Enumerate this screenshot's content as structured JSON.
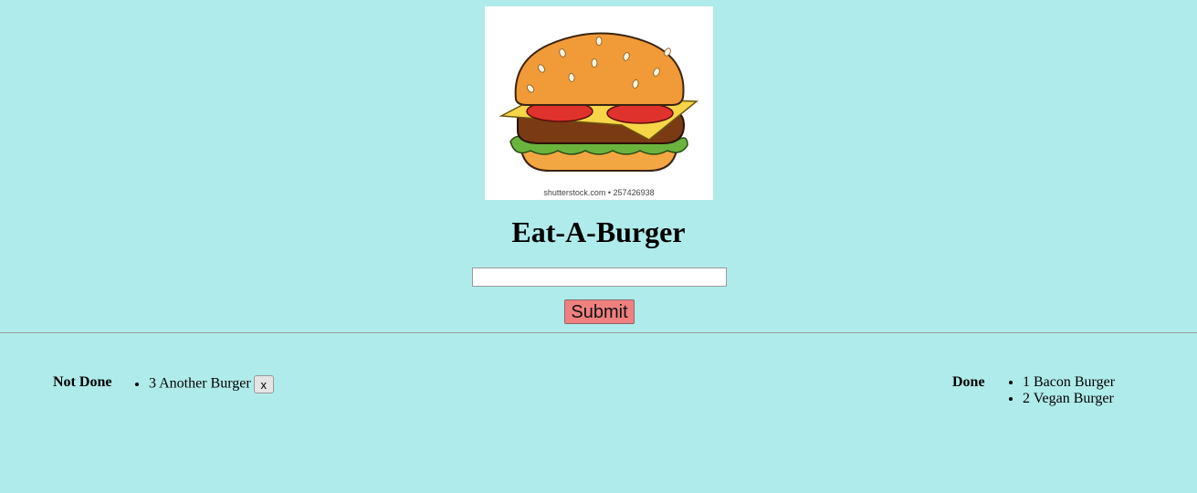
{
  "logo": {
    "icon": "hamburger-illustration",
    "credit": "shutterstock.com • 257426938"
  },
  "header": {
    "title": "Eat-A-Burger"
  },
  "form": {
    "input_value": "",
    "submit_label": "Submit"
  },
  "not_done": {
    "label": "Not Done",
    "items": [
      {
        "text": "3 Another Burger",
        "action_label": "x"
      }
    ]
  },
  "done": {
    "label": "Done",
    "items": [
      {
        "text": "1 Bacon Burger"
      },
      {
        "text": "2 Vegan Burger"
      }
    ]
  },
  "colors": {
    "background": "#afebea",
    "submit_button": "#f08080"
  }
}
